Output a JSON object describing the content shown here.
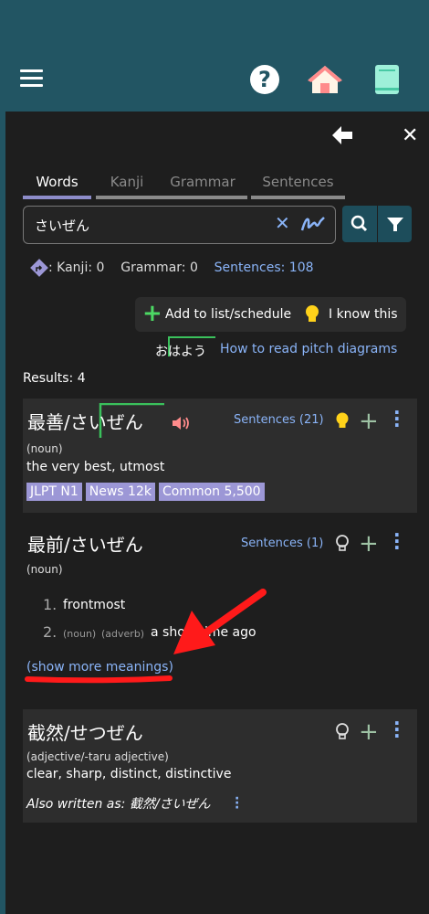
{
  "colors": {
    "topbar": "#225563",
    "panel": "#1e1e1e",
    "link": "#8ab4f8",
    "tag": "#9c97d6",
    "active_tab": "#8d8cc9",
    "accent_red": "#ff1a1a"
  },
  "topbar": {
    "help_glyph": "?"
  },
  "tabs": [
    {
      "label": "Words",
      "active": true
    },
    {
      "label": "Kanji"
    },
    {
      "label": "Grammar"
    },
    {
      "label": "Sentences"
    }
  ],
  "search": {
    "value": "さいぜん",
    "clear_glyph": "✕"
  },
  "counts": {
    "kanji": ": Kanji: 0",
    "grammar": "Grammar: 0",
    "sentences": "Sentences: 108"
  },
  "actions": {
    "add": "Add to list/schedule",
    "know": "I know this",
    "pitch_example": "おはよう",
    "pitch_link": "How to read pitch diagrams"
  },
  "results_label": "Results: 4",
  "entries": [
    {
      "word": "最善/さいぜん",
      "sentences": "Sentences (21)",
      "pos": "(noun)",
      "gloss": "the very best, utmost",
      "tags": [
        "JLPT N1",
        "News 12k",
        "Common 5,500"
      ]
    },
    {
      "word": "最前/さいぜん",
      "sentences": "Sentences (1)",
      "pos": "(noun)",
      "meanings": [
        {
          "num": "1.",
          "text": "frontmost"
        },
        {
          "num": "2.",
          "pos1": "(noun)",
          "pos2": "(adverb)",
          "text": "a short time ago"
        }
      ],
      "show_more": "(show more meanings)"
    },
    {
      "word": "截然/せつぜん",
      "pos": "(adjective/-taru adjective)",
      "gloss": "clear, sharp, distinct, distinctive",
      "also_written": "Also written as: 截然/さいぜん"
    }
  ]
}
